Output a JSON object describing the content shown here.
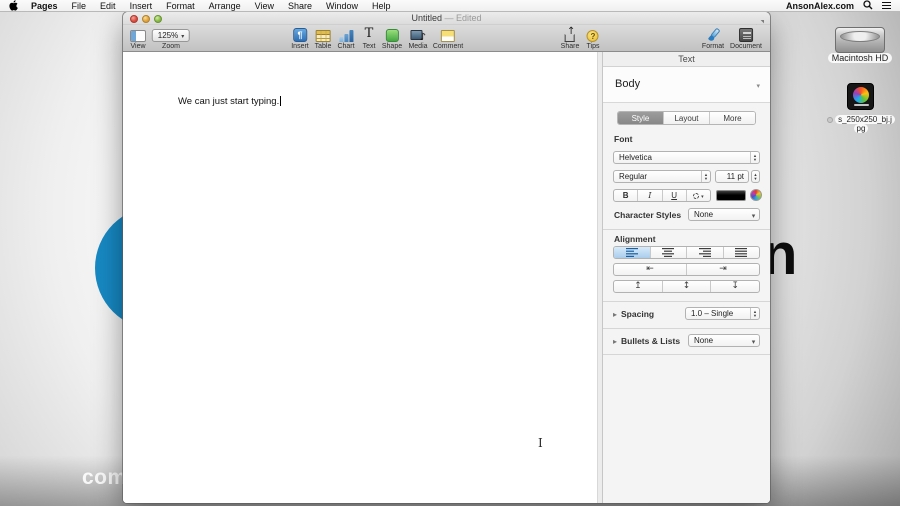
{
  "menu_bar": {
    "items": [
      "Pages",
      "File",
      "Edit",
      "Insert",
      "Format",
      "Arrange",
      "View",
      "Share",
      "Window",
      "Help"
    ],
    "right_text": "AnsonAlex.com"
  },
  "window": {
    "title": "Untitled",
    "edited_status": "— Edited",
    "toolbar": {
      "view_label": "View",
      "zoom_label": "Zoom",
      "zoom_value": "125%",
      "insert_label": "Insert",
      "table_label": "Table",
      "chart_label": "Chart",
      "text_label": "Text",
      "shape_label": "Shape",
      "media_label": "Media",
      "comment_label": "Comment",
      "share_label": "Share",
      "tips_label": "Tips",
      "format_label": "Format",
      "document_label": "Document"
    }
  },
  "document": {
    "body_text": "We can just start typing."
  },
  "format_panel": {
    "header": "Text",
    "paragraph_style": "Body",
    "tabs": [
      "Style",
      "Layout",
      "More"
    ],
    "active_tab": "Style",
    "font": {
      "section_label": "Font",
      "family": "Helvetica",
      "weight": "Regular",
      "size": "11 pt",
      "bold": "B",
      "italic": "I",
      "underline": "U"
    },
    "character_styles": {
      "label": "Character Styles",
      "value": "None"
    },
    "alignment_label": "Alignment",
    "spacing": {
      "label": "Spacing",
      "value": "1.0 – Single"
    },
    "bullets": {
      "label": "Bullets & Lists",
      "value": "None"
    }
  },
  "desktop": {
    "volume_label": "Macintosh HD",
    "file_label_line1": "s_250x250_bj.j",
    "file_label_line2": "pg",
    "wallpaper_letter": "n",
    "wallpaper_text": "com"
  },
  "colors": {
    "accent_blue": "#1789c4",
    "selection_blue": "#a9cdec",
    "selected_segment_gray": "#8f8f8f",
    "font_color_well": "#000000"
  }
}
